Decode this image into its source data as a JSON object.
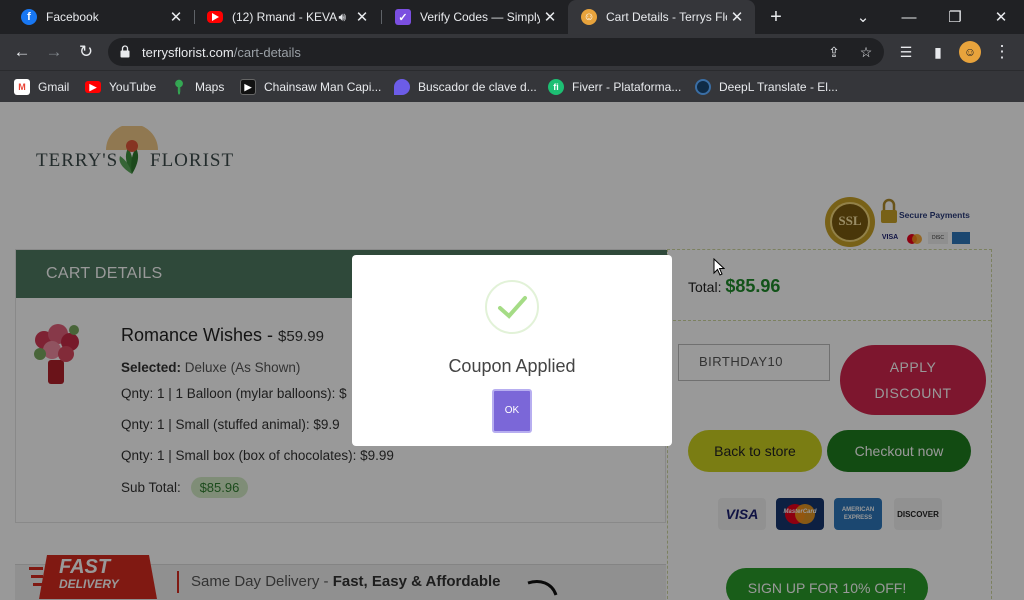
{
  "browser": {
    "tabs": [
      {
        "title": "Facebook",
        "favicon": "facebook-icon",
        "color": "#1877f2"
      },
      {
        "title": "(12) Rmand - KEVA",
        "favicon": "youtube-icon",
        "color": "#ff0000"
      },
      {
        "title": "Verify Codes — SimplyC",
        "favicon": "simplycodes-icon",
        "color": "#7b4fe0"
      },
      {
        "title": "Cart Details - Terrys Flo",
        "favicon": "terrys-florist-icon",
        "color": "#e8a33c",
        "active": true
      }
    ],
    "new_tab_symbol": "+",
    "url_domain": "terrysflorist.com",
    "url_path": "/cart-details",
    "bookmarks": [
      {
        "label": "Gmail",
        "icon": "gmail-icon"
      },
      {
        "label": "YouTube",
        "icon": "youtube-icon"
      },
      {
        "label": "Maps",
        "icon": "maps-icon"
      },
      {
        "label": "Chainsaw Man Capi...",
        "icon": "chainsaw-man-icon"
      },
      {
        "label": "Buscador de clave d...",
        "icon": "buscador-icon"
      },
      {
        "label": "Fiverr - Plataforma...",
        "icon": "fiverr-icon"
      },
      {
        "label": "DeepL Translate - El...",
        "icon": "deepl-icon"
      }
    ]
  },
  "site": {
    "logo_text_left": "TERRY'S",
    "logo_text_right": "FLORIST",
    "secure_text": "Secure Payments",
    "ssl_text": "SSL"
  },
  "cart": {
    "heading": "CART DETAILS",
    "product_name": "Romance Wishes",
    "product_price": "$59.99",
    "selected_label": "Selected:",
    "selected_value": "Deluxe (As Shown)",
    "lines": [
      "Qnty: 1 | 1 Balloon (mylar balloons): $",
      "Qnty: 1 | Small (stuffed animal): $9.9",
      "Qnty: 1 | Small box (box of chocolates): $9.99"
    ],
    "subtotal_label": "Sub Total:",
    "subtotal_value": "$85.96"
  },
  "summary": {
    "total_label": "Total:",
    "total_value": "$85.96",
    "coupon_value": "BIRTHDAY10",
    "apply_label_line1": "APPLY",
    "apply_label_line2": "DISCOUNT",
    "back_label": "Back to store",
    "checkout_label": "Checkout now",
    "cards": [
      "VISA",
      "MasterCard",
      "AMERICAN EXPRESS",
      "DISCOVER"
    ],
    "signup_label": "SIGN UP FOR 10% OFF!"
  },
  "banner": {
    "badge_line1": "FAST",
    "badge_line2": "DELIVERY",
    "tag_plain": "Same Day Delivery - ",
    "tag_bold": "Fast, Easy & Affordable"
  },
  "modal": {
    "title": "Coupon Applied",
    "ok_label": "OK"
  },
  "colors": {
    "cart_header": "#4f7a62",
    "apply": "#d0264e",
    "back": "#cbd021",
    "checkout": "#1e7d1e",
    "total": "#1e8a2a",
    "ok": "#7b67d8"
  }
}
